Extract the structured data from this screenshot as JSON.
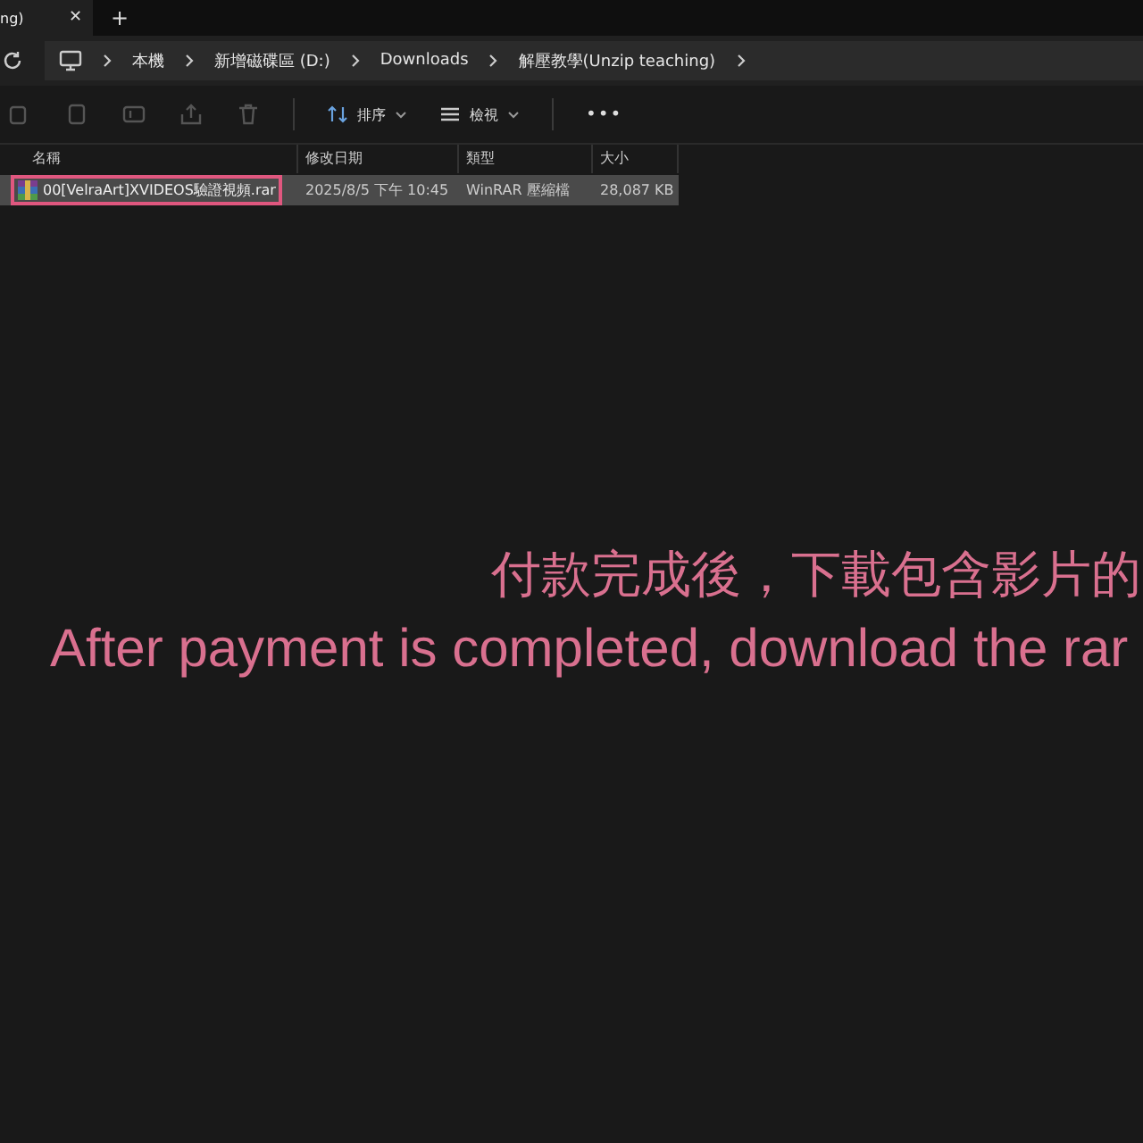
{
  "tab": {
    "title": "ng)",
    "close": "✕",
    "new_tab": "+"
  },
  "address": {
    "crumbs": [
      "本機",
      "新增磁碟區 (D:)",
      "Downloads",
      "解壓教學(Unzip teaching)"
    ]
  },
  "toolbar": {
    "sort": "排序",
    "view": "檢視",
    "more": "•••"
  },
  "columns": [
    "名稱",
    "修改日期",
    "類型",
    "大小"
  ],
  "rows": [
    {
      "name": "00[VelraArt]XVIDEOS驗證視頻.rar",
      "modified": "2025/8/5 下午 10:45",
      "type": "WinRAR 壓縮檔",
      "size": "28,087 KB",
      "selected": true
    }
  ],
  "captions": [
    "付款完成後，下載包含影片的",
    "After payment is completed, download the rar"
  ]
}
